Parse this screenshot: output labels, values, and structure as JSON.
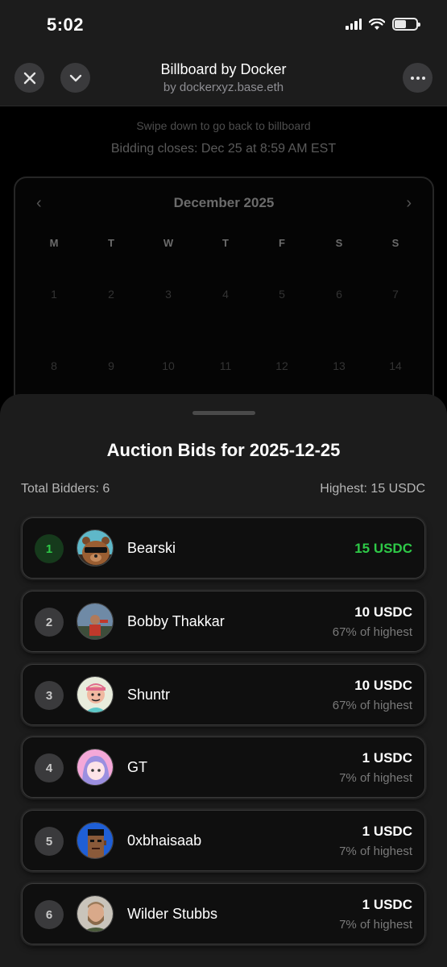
{
  "status_bar": {
    "time": "5:02"
  },
  "header": {
    "title": "Billboard by Docker",
    "subtitle": "by dockerxyz.base.eth"
  },
  "background": {
    "hint": "Swipe down to go back to billboard",
    "closes": "Bidding closes: Dec 25 at 8:59 AM EST",
    "calendar": {
      "month": "December 2025",
      "prev": "‹",
      "next": "›",
      "weekdays": [
        "M",
        "T",
        "W",
        "T",
        "F",
        "S",
        "S"
      ],
      "week1": [
        "1",
        "2",
        "3",
        "4",
        "5",
        "6",
        "7"
      ],
      "week2": [
        "8",
        "9",
        "10",
        "11",
        "12",
        "13",
        "14"
      ]
    }
  },
  "sheet": {
    "title": "Auction Bids for 2025-12-25",
    "total_bidders": "Total Bidders: 6",
    "highest": "Highest: 15 USDC",
    "bids": [
      {
        "rank": "1",
        "name": "Bearski",
        "amount": "15 USDC",
        "pct": "",
        "avatar": "bear-avatar-icon"
      },
      {
        "rank": "2",
        "name": "Bobby Thakkar",
        "amount": "10 USDC",
        "pct": "67% of highest",
        "avatar": "photo-avatar-icon"
      },
      {
        "rank": "3",
        "name": "Shuntr",
        "amount": "10 USDC",
        "pct": "67% of highest",
        "avatar": "cartoon-avatar-icon"
      },
      {
        "rank": "4",
        "name": "GT",
        "amount": "1 USDC",
        "pct": "7% of highest",
        "avatar": "anime-avatar-icon"
      },
      {
        "rank": "5",
        "name": "0xbhaisaab",
        "amount": "1 USDC",
        "pct": "7% of highest",
        "avatar": "pixel-punk-avatar-icon"
      },
      {
        "rank": "6",
        "name": "Wilder Stubbs",
        "amount": "1 USDC",
        "pct": "7% of highest",
        "avatar": "photo-avatar-icon"
      }
    ]
  },
  "colors": {
    "accent_green": "#2ec947",
    "sheet_bg": "#1c1c1c",
    "card_bg": "#0f0f0f"
  }
}
